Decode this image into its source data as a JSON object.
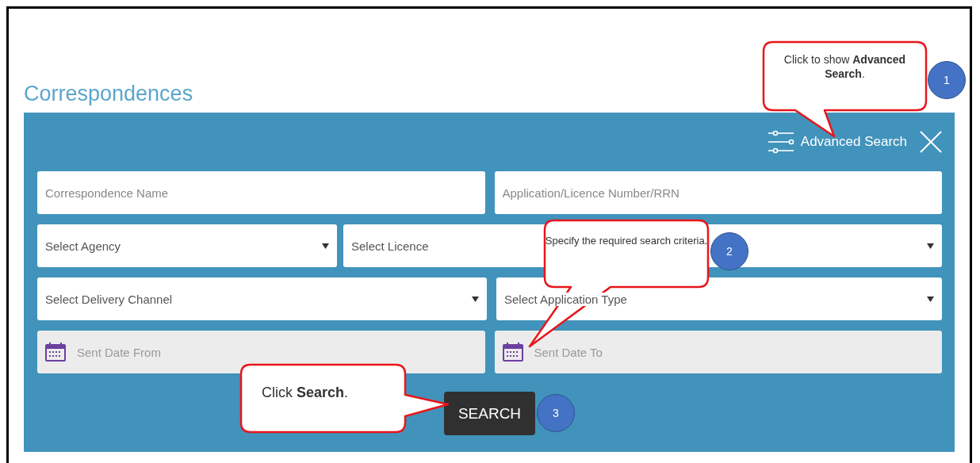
{
  "page": {
    "title": "Correspondences"
  },
  "panel": {
    "advanced_search": "Advanced Search",
    "rows": [
      [
        {
          "kind": "text",
          "placeholder": "Correspondence Name"
        },
        {
          "kind": "text",
          "placeholder": "Application/Licence Number/RRN"
        }
      ],
      [
        {
          "kind": "select",
          "placeholder": "Select Agency"
        },
        {
          "kind": "select",
          "placeholder": "Select Licence"
        }
      ],
      [
        {
          "kind": "select",
          "placeholder": "Select Delivery Channel"
        },
        {
          "kind": "select",
          "placeholder": "Select Application Type"
        }
      ],
      [
        {
          "kind": "date",
          "placeholder": "Sent Date From"
        },
        {
          "kind": "date",
          "placeholder": "Sent Date To"
        }
      ]
    ],
    "search_button": "SEARCH"
  },
  "callouts": [
    {
      "text": "Click to show **Advanced Search**.",
      "step": "1"
    },
    {
      "text": "Specify the required search criteria.",
      "step": "2"
    },
    {
      "text": "Click **Search**.",
      "step": "3"
    }
  ]
}
